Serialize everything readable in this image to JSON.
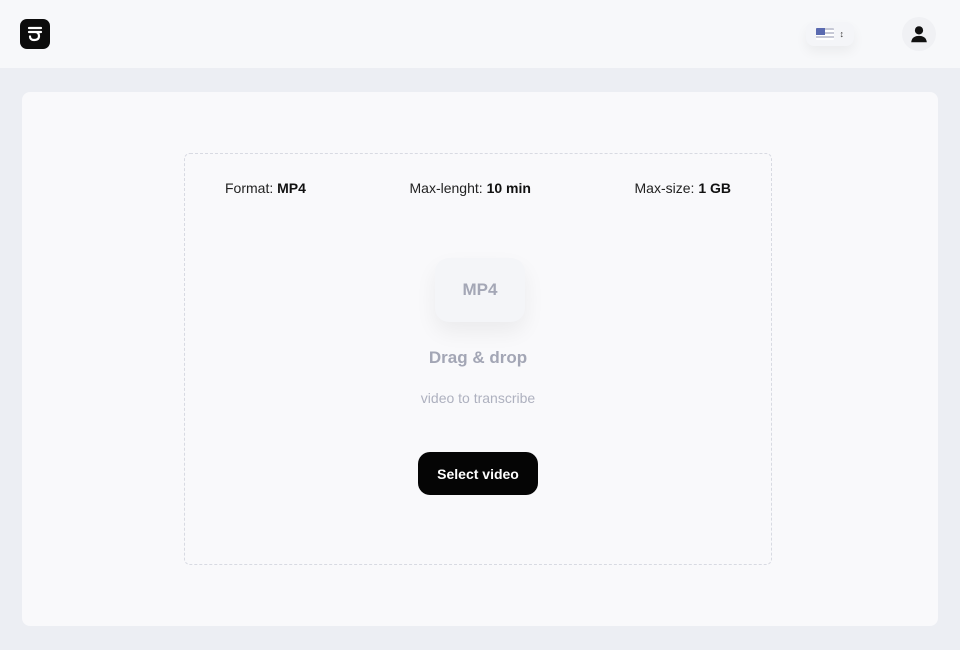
{
  "header": {
    "logo_icon": "transcribe-logo-icon",
    "language_icon": "us-flag-icon",
    "language_toggle_icon": "updown-chevron-icon",
    "user_icon": "user-avatar-icon"
  },
  "dropzone": {
    "specs": {
      "format_label": "Format:",
      "format_value": "MP4",
      "length_label": "Max-lenght:",
      "length_value": "10 min",
      "size_label": "Max-size:",
      "size_value": "1 GB"
    },
    "file_badge": "MP4",
    "title": "Drag & drop",
    "subtitle": "video to transcribe",
    "button_label": "Select video"
  },
  "colors": {
    "background": "#eceef3",
    "header": "#f7f8fa",
    "card": "#f9f9fb",
    "button": "#050505",
    "muted_text": "#a3a6b5"
  }
}
